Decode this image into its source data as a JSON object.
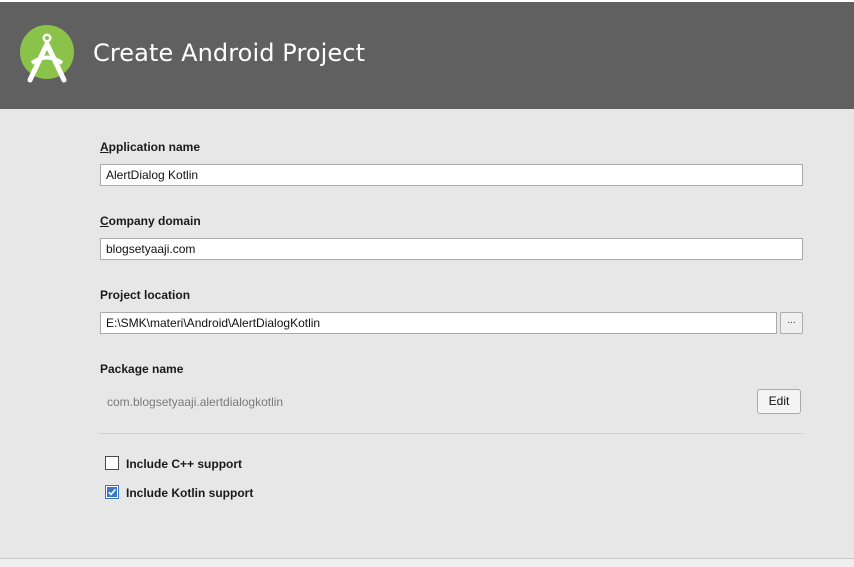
{
  "header": {
    "title": "Create Android Project",
    "logo": "android-studio-logo",
    "background": "#606060"
  },
  "form": {
    "app_name": {
      "mnemonic": "A",
      "label_rest": "pplication name",
      "value": "AlertDialog Kotlin"
    },
    "company_domain": {
      "mnemonic": "C",
      "label_rest": "ompany domain",
      "value": "blogsetyaaji.com"
    },
    "project_location": {
      "label": "Project location",
      "value": "E:\\SMK\\materi\\Android\\AlertDialogKotlin",
      "browse_label": "..."
    },
    "package_name": {
      "label": "Package name",
      "value": "com.blogsetyaaji.alertdialogkotlin",
      "edit_label": "Edit"
    },
    "include_cpp": {
      "label": "Include C++ support",
      "checked": false
    },
    "include_kotlin": {
      "label": "Include Kotlin support",
      "checked": true
    }
  },
  "colors": {
    "content_bg": "#e7e7e7",
    "logo_green": "#8bc34a",
    "checkbox_accent": "#3a78c8"
  }
}
